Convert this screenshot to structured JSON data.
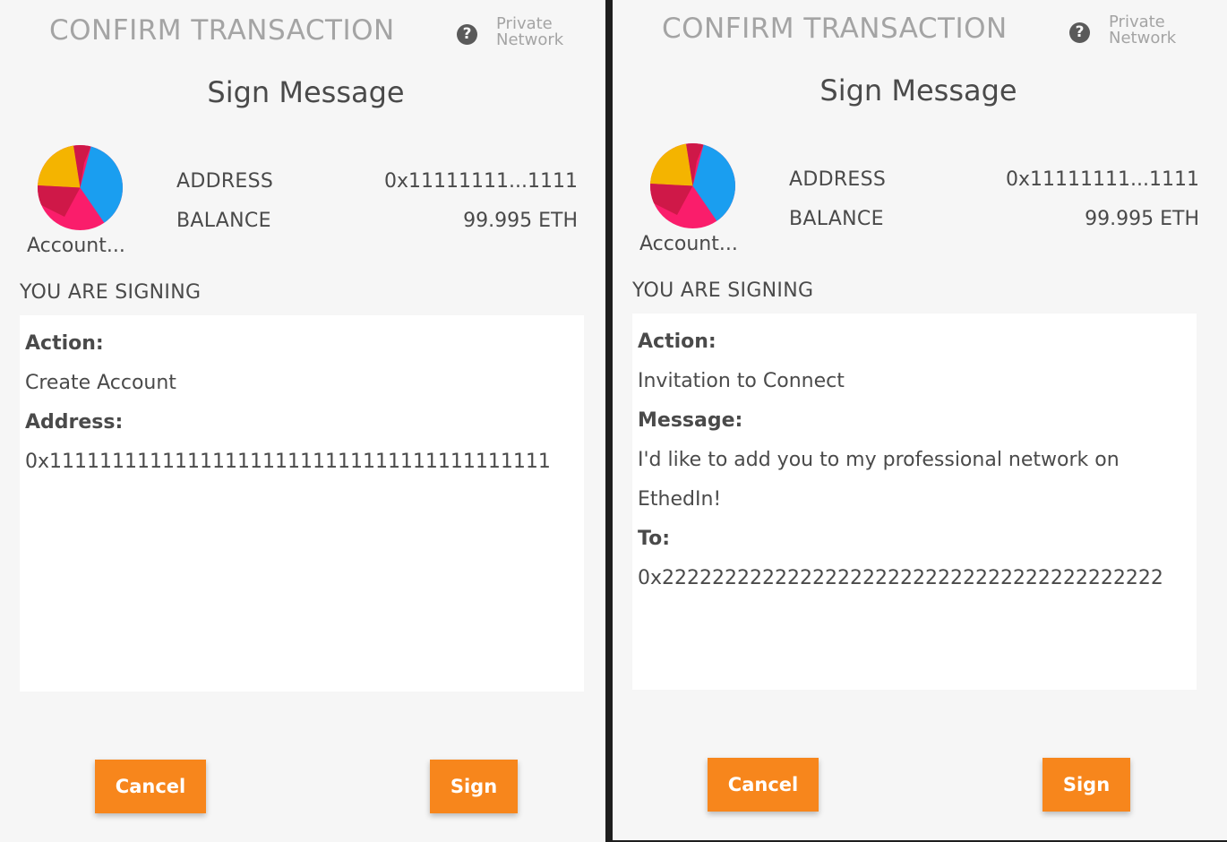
{
  "panels": [
    {
      "header_title": "CONFIRM TRANSACTION",
      "network_line1": "Private",
      "network_line2": "Network",
      "sign_title": "Sign Message",
      "account_name": "Account...",
      "address_label": "ADDRESS",
      "address_value": "0x11111111...1111",
      "balance_label": "BALANCE",
      "balance_value": "99.995 ETH",
      "signing_label": "YOU ARE SIGNING",
      "message_lines": [
        {
          "text": "Action:",
          "key": true
        },
        {
          "text": "Create Account",
          "key": false
        },
        {
          "text": "Address:",
          "key": true
        },
        {
          "text": "0x1111111111111111111111111111111111111111",
          "key": false
        }
      ],
      "cancel_label": "Cancel",
      "sign_label": "Sign"
    },
    {
      "header_title": "CONFIRM TRANSACTION",
      "network_line1": "Private",
      "network_line2": "Network",
      "sign_title": "Sign Message",
      "account_name": "Account...",
      "address_label": "ADDRESS",
      "address_value": "0x11111111...1111",
      "balance_label": "BALANCE",
      "balance_value": "99.995 ETH",
      "signing_label": "YOU ARE SIGNING",
      "message_lines": [
        {
          "text": "Action:",
          "key": true
        },
        {
          "text": "Invitation to Connect",
          "key": false
        },
        {
          "text": "Message:",
          "key": true
        },
        {
          "text": "I'd like to add you to my professional network on",
          "key": false
        },
        {
          "text": "EthedIn!",
          "key": false
        },
        {
          "text": "To:",
          "key": true
        },
        {
          "text": "0x2222222222222222222222222222222222222222",
          "key": false
        }
      ],
      "cancel_label": "Cancel",
      "sign_label": "Sign"
    }
  ],
  "icons": {
    "help": "question-circle-icon",
    "avatar": "identicon-pie"
  },
  "colors": {
    "accent": "#f7861c",
    "panel_bg": "#f6f6f6",
    "divider": "#1e1e1e",
    "muted_text": "#a4a4a4",
    "text": "#4a4a4a",
    "avatar_yellow": "#f4b400",
    "avatar_blue": "#1a9ef0",
    "avatar_pink": "#fa1d6b",
    "avatar_crimson": "#cf1848"
  }
}
